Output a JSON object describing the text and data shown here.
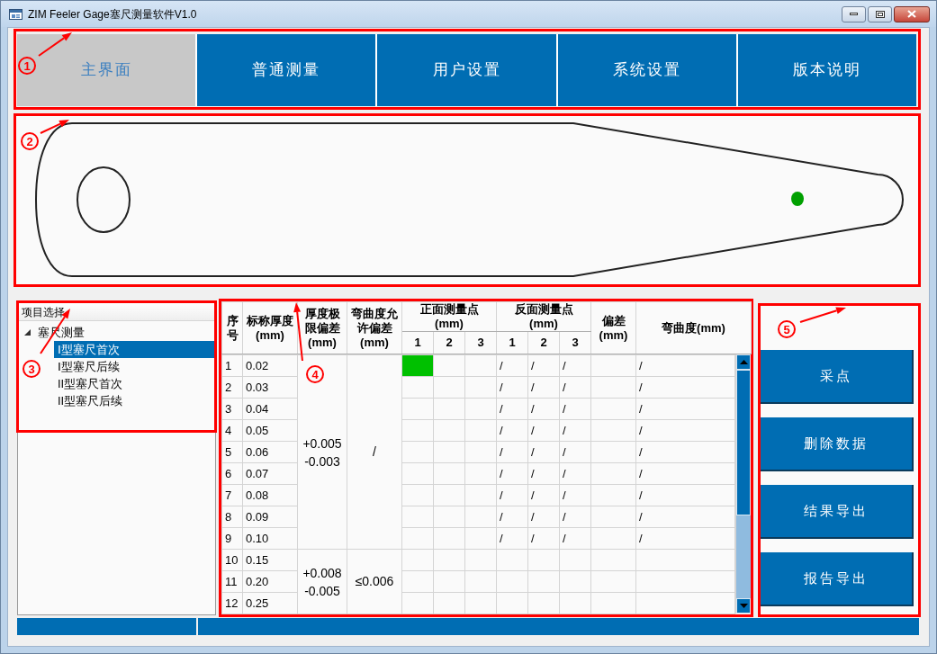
{
  "window": {
    "title": "ZIM Feeler Gage塞尺测量软件V1.0"
  },
  "nav_tabs": [
    {
      "label": "主界面",
      "selected": true
    },
    {
      "label": "普通测量",
      "selected": false
    },
    {
      "label": "用户设置",
      "selected": false
    },
    {
      "label": "系统设置",
      "selected": false
    },
    {
      "label": "版本说明",
      "selected": false
    }
  ],
  "project_tree": {
    "header": "项目选择",
    "items": [
      {
        "label": "塞尺测量",
        "expanded": true,
        "selected": false,
        "children": [
          {
            "label": "Ⅰ型塞尺首次",
            "selected": true
          },
          {
            "label": "Ⅰ型塞尺后续",
            "selected": false
          },
          {
            "label": "II型塞尺首次",
            "selected": false
          },
          {
            "label": "II型塞尺后续",
            "selected": false
          }
        ]
      }
    ]
  },
  "table": {
    "columns": [
      {
        "kind": "single",
        "label": "序号"
      },
      {
        "kind": "single",
        "label": "标称厚度\n(mm)"
      },
      {
        "kind": "single",
        "label": "厚度极限偏差\n(mm)"
      },
      {
        "kind": "single",
        "label": "弯曲度允许偏差\n(mm)"
      },
      {
        "kind": "group",
        "label": "正面测量点\n(mm)",
        "sub": [
          "1",
          "2",
          "3"
        ]
      },
      {
        "kind": "group",
        "label": "反面测量点\n(mm)",
        "sub": [
          "1",
          "2",
          "3"
        ]
      },
      {
        "kind": "single",
        "label": "偏差\n(mm)"
      },
      {
        "kind": "single",
        "label": "弯曲度(mm)"
      }
    ],
    "groups": [
      {
        "tolerance": "+0.005\n-0.003",
        "bend_allowance": "/",
        "rows": [
          {
            "no": "1",
            "nominal": "0.02",
            "front": [
              {
                "active": true
              },
              {
                "active": false
              },
              {
                "active": false
              }
            ],
            "back": [
              "/",
              "/",
              "/"
            ],
            "bend": "/"
          },
          {
            "no": "2",
            "nominal": "0.03",
            "front": [
              {
                "active": false
              },
              {
                "active": false
              },
              {
                "active": false
              }
            ],
            "back": [
              "/",
              "/",
              "/"
            ],
            "bend": "/"
          },
          {
            "no": "3",
            "nominal": "0.04",
            "front": [
              {
                "active": false
              },
              {
                "active": false
              },
              {
                "active": false
              }
            ],
            "back": [
              "/",
              "/",
              "/"
            ],
            "bend": "/"
          },
          {
            "no": "4",
            "nominal": "0.05",
            "front": [
              {
                "active": false
              },
              {
                "active": false
              },
              {
                "active": false
              }
            ],
            "back": [
              "/",
              "/",
              "/"
            ],
            "bend": "/"
          },
          {
            "no": "5",
            "nominal": "0.06",
            "front": [
              {
                "active": false
              },
              {
                "active": false
              },
              {
                "active": false
              }
            ],
            "back": [
              "/",
              "/",
              "/"
            ],
            "bend": "/"
          },
          {
            "no": "6",
            "nominal": "0.07",
            "front": [
              {
                "active": false
              },
              {
                "active": false
              },
              {
                "active": false
              }
            ],
            "back": [
              "/",
              "/",
              "/"
            ],
            "bend": "/"
          },
          {
            "no": "7",
            "nominal": "0.08",
            "front": [
              {
                "active": false
              },
              {
                "active": false
              },
              {
                "active": false
              }
            ],
            "back": [
              "/",
              "/",
              "/"
            ],
            "bend": "/"
          },
          {
            "no": "8",
            "nominal": "0.09",
            "front": [
              {
                "active": false
              },
              {
                "active": false
              },
              {
                "active": false
              }
            ],
            "back": [
              "/",
              "/",
              "/"
            ],
            "bend": "/"
          },
          {
            "no": "9",
            "nominal": "0.10",
            "front": [
              {
                "active": false
              },
              {
                "active": false
              },
              {
                "active": false
              }
            ],
            "back": [
              "/",
              "/",
              "/"
            ],
            "bend": "/"
          }
        ]
      },
      {
        "tolerance": "+0.008\n-0.005",
        "bend_allowance": "≤0.006",
        "rows": [
          {
            "no": "10",
            "nominal": "0.15",
            "front": [
              {
                "active": false
              },
              {
                "active": false
              },
              {
                "active": false
              }
            ]
          },
          {
            "no": "11",
            "nominal": "0.20",
            "front": [
              {
                "active": false
              },
              {
                "active": false
              },
              {
                "active": false
              }
            ]
          },
          {
            "no": "12",
            "nominal": "0.25",
            "front": [
              {
                "active": false
              },
              {
                "active": false
              },
              {
                "active": false
              }
            ]
          }
        ]
      }
    ]
  },
  "action_buttons": [
    {
      "label": "采点"
    },
    {
      "label": "删除数据"
    },
    {
      "label": "结果导出"
    },
    {
      "label": "报告导出"
    }
  ],
  "annotations": [
    {
      "label": "1"
    },
    {
      "label": "2"
    },
    {
      "label": "3"
    },
    {
      "label": "4"
    },
    {
      "label": "5"
    }
  ]
}
